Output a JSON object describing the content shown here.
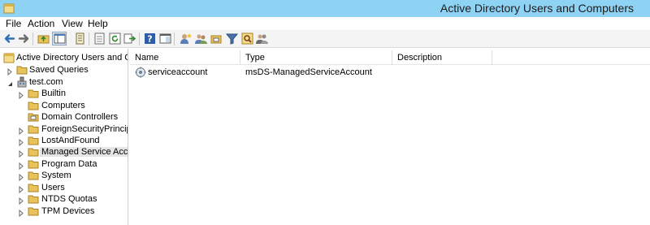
{
  "window": {
    "title": "Active Directory Users and Computers"
  },
  "menu": [
    "File",
    "Action",
    "View",
    "Help"
  ],
  "toolbar": [
    "back-icon",
    "forward-icon",
    "up-folder-icon",
    "console-tree-icon",
    "properties-icon",
    "export-list-icon",
    "refresh-icon",
    "export-icon",
    "help-icon",
    "show-console-icon",
    "new-user-icon",
    "new-group-icon",
    "new-ou-icon",
    "filter-icon",
    "find-icon",
    "add-to-group-icon"
  ],
  "tree": {
    "root": "Active Directory Users and Com",
    "saved_queries": "Saved Queries",
    "domain": "test.com",
    "children": [
      "Builtin",
      "Computers",
      "Domain Controllers",
      "ForeignSecurityPrincipals",
      "LostAndFound",
      "Managed Service Accounts",
      "Program Data",
      "System",
      "Users",
      "NTDS Quotas",
      "TPM Devices"
    ]
  },
  "list": {
    "columns": [
      "Name",
      "Type",
      "Description"
    ],
    "rows": [
      {
        "name": "serviceaccount",
        "type": "msDS-ManagedServiceAccount",
        "description": ""
      }
    ]
  },
  "colors": {
    "titlebar": "#8fd3f4",
    "folder": "#e8c25a",
    "selection": "#e5e5e5"
  }
}
